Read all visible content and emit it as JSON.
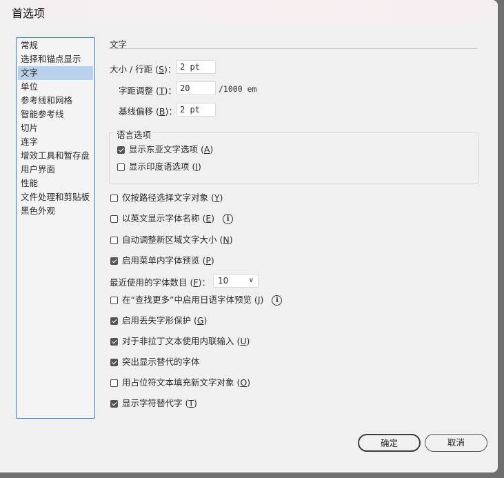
{
  "window": {
    "title": "首选项"
  },
  "sidebar": {
    "items": [
      {
        "label": "常规"
      },
      {
        "label": "选择和锚点显示"
      },
      {
        "label": "文字",
        "selected": true
      },
      {
        "label": "单位"
      },
      {
        "label": "参考线和网格"
      },
      {
        "label": "智能参考线"
      },
      {
        "label": "切片"
      },
      {
        "label": "连字"
      },
      {
        "label": "增效工具和暂存盘"
      },
      {
        "label": "用户界面"
      },
      {
        "label": "性能"
      },
      {
        "label": "文件处理和剪贴板"
      },
      {
        "label": "黑色外观"
      }
    ]
  },
  "section": {
    "title": "文字"
  },
  "fields": {
    "size": {
      "label": "大小 / 行距 (",
      "key": "S",
      "suffix": ")：",
      "value": "2 pt"
    },
    "tracking": {
      "label": "字距调整 (",
      "key": "T",
      "suffix": ")：",
      "value": "20",
      "unit": "/1000 em"
    },
    "baseline": {
      "label": "基线偏移 (",
      "key": "B",
      "suffix": ")：",
      "value": "2 pt"
    }
  },
  "language": {
    "legend": "语言选项",
    "options": [
      {
        "label": "显示东亚文字选项 (",
        "key": "A",
        "suffix": ")",
        "checked": true
      },
      {
        "label": "显示印度语选项 (",
        "key": "I",
        "suffix": ")",
        "checked": false
      }
    ]
  },
  "options": [
    {
      "label": "仅按路径选择文字对象 (",
      "key": "Y",
      "suffix": ")",
      "checked": false
    },
    {
      "label": "以英文显示字体名称 (",
      "key": "E",
      "suffix": ")",
      "checked": false,
      "info": "i"
    },
    {
      "label": "自动调整新区域文字大小 (",
      "key": "N",
      "suffix": ")",
      "checked": false
    },
    {
      "label": "启用菜单内字体预览 (",
      "key": "P",
      "suffix": ")",
      "checked": true
    }
  ],
  "recent_fonts": {
    "label": "最近使用的字体数目 (",
    "key": "F",
    "suffix": ")：",
    "value": "10"
  },
  "options2": [
    {
      "label": "在“查找更多”中启用日语字体预览 (",
      "key": "J",
      "suffix": ")",
      "checked": false,
      "info": "i"
    },
    {
      "label": "启用丢失字形保护 (",
      "key": "G",
      "suffix": ")",
      "checked": true
    },
    {
      "label": "对于非拉丁文本使用内联输入 (",
      "key": "U",
      "suffix": ")",
      "checked": true
    },
    {
      "label": "突出显示替代的字体",
      "key": "",
      "suffix": "",
      "checked": true
    },
    {
      "label": "用占位符文本填充新文字对象 (",
      "key": "O",
      "suffix": ")",
      "checked": false
    },
    {
      "label": "显示字符替代字 (",
      "key": "T",
      "suffix": ")",
      "checked": true
    }
  ],
  "buttons": {
    "ok": "确定",
    "cancel": "取消"
  }
}
